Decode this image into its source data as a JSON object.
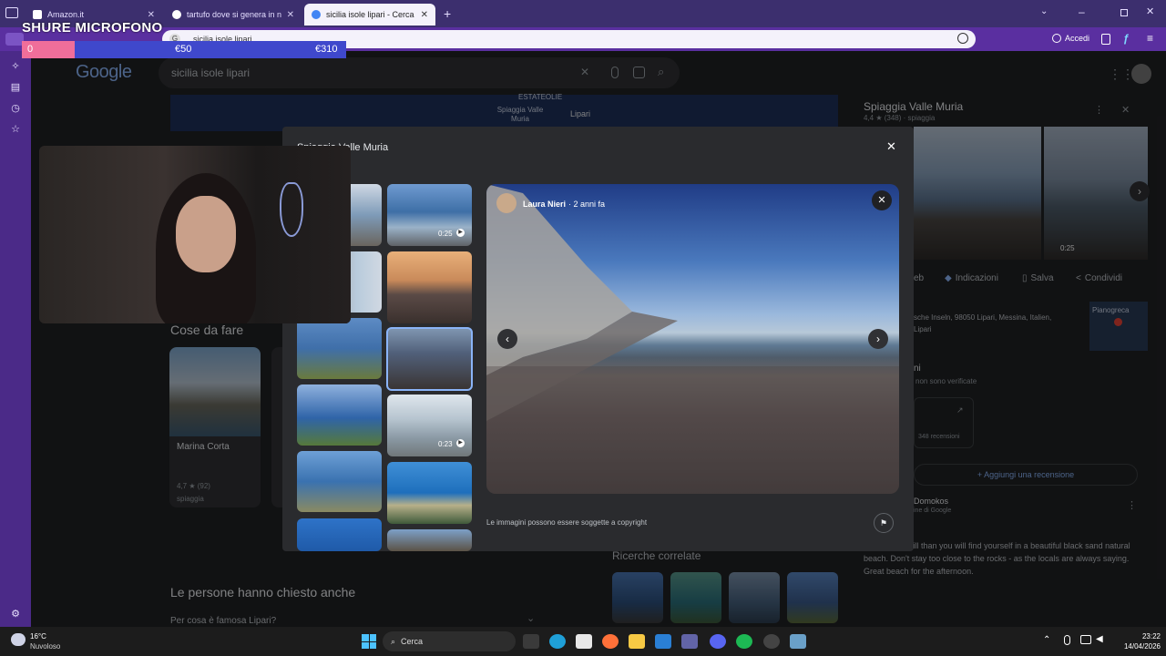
{
  "browser": {
    "tabs": [
      {
        "title": "Amazon.it"
      },
      {
        "title": "tartufo dove si genera in natura"
      },
      {
        "title": "sicilia isole lipari - Cerca con Go"
      }
    ],
    "address": "sicilia isole lipari",
    "signin_label": "Accedi"
  },
  "stream_overlay": {
    "title": "SHURE MICROFONO",
    "goal_current": "0",
    "goal_mid": "€50",
    "goal_target": "€310"
  },
  "google": {
    "logo": "Google",
    "query": "sicilia isole lipari",
    "map_labels": [
      "ESTATEOLIE",
      "Spiaggia Valle Muria",
      "Lipari"
    ],
    "things_to_do_title": "Cose da fare",
    "thing_card": {
      "name": "Marina Corta",
      "rating": "4,7 ★ (92)",
      "type": "spiaggia"
    },
    "people_also_ask": "Le persone hanno chiesto anche",
    "paa_item": "Per cosa è famosa Lipari?",
    "related_title": "Ricerche correlate"
  },
  "knowledge_panel": {
    "title": "Spiaggia Valle Muria",
    "rating_line": "4,4 ★ (348) · spiaggia",
    "video_time": "0:25",
    "actions": [
      "eb",
      "Indicazioni",
      "Salva",
      "Condividi"
    ],
    "address": "sche Inseln, 98050 Lipari, Messina, Italien,",
    "address2": "Lipari",
    "map_label": "Pianogreca",
    "reviews_head": "ni",
    "reviews_note": "non sono verificate",
    "reviews_count": "348 recensioni",
    "add_review": "Aggiungi una recensione",
    "reviewer": "Domokos",
    "reviewer_sub": "ine di Google",
    "review_text": "h walk downhill than you will find yourself in a beautiful black sand natural beach. Don't stay too close to the rocks - as the locals are always saying. Great beach for the afternoon."
  },
  "modal": {
    "title": "Spiaggia Valle Muria",
    "author": "Laura Nieri",
    "time": "2 anni fa",
    "copyright": "Le immagini possono essere soggette a copyright",
    "thumb_video_times": [
      "0:25",
      "0:23"
    ]
  },
  "taskbar": {
    "weather_temp": "16°C",
    "weather_desc": "Nuvoloso",
    "search_label": "Cerca",
    "time": "23:22",
    "date": "14/04/2026"
  }
}
